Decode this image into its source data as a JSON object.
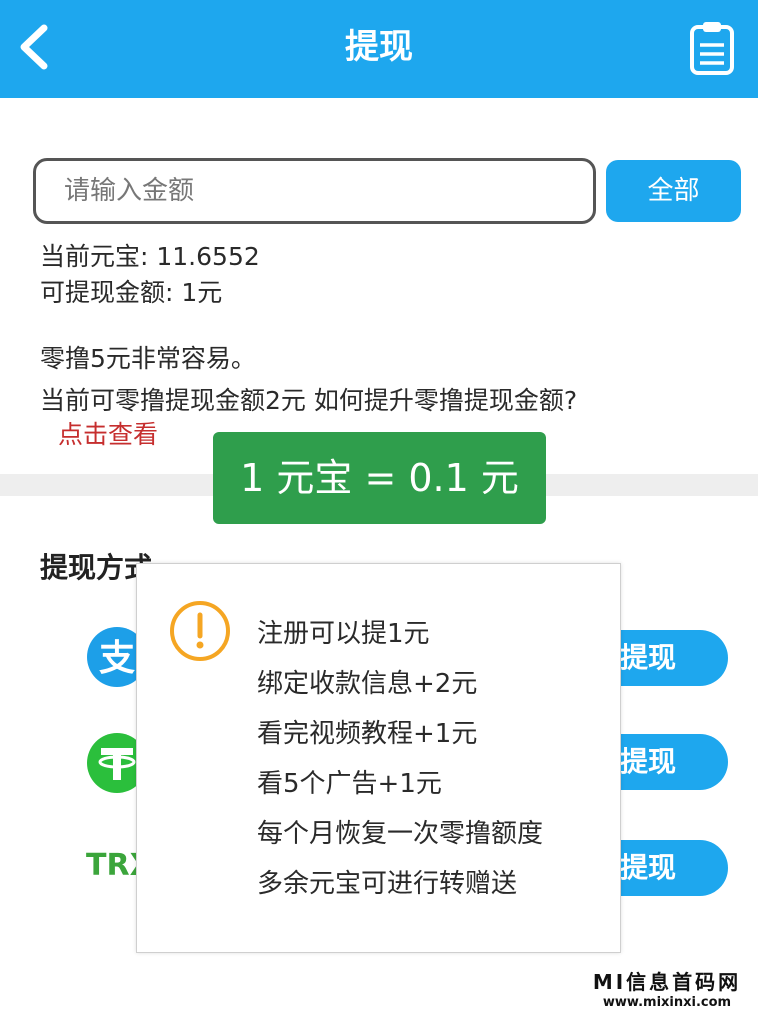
{
  "header": {
    "title": "提现",
    "back_icon": "chevron-left-icon",
    "records_icon": "clipboard-icon",
    "color": "#1ea7ee"
  },
  "amount": {
    "placeholder": "请输入金额",
    "value": "",
    "all_button": "全部"
  },
  "balance": {
    "current": "当前元宝: 11.6552",
    "withdrawable": "可提现金额: 1元"
  },
  "notice": {
    "line1": "零撸5元非常容易。",
    "line2": "当前可零撸提现金额2元 如何提升零撸提现金额?",
    "link": "点击查看"
  },
  "rate_banner": "1 元宝 = 0.1 元",
  "methods": {
    "title": "提现方式",
    "items": [
      {
        "icon": "alipay-icon",
        "button": "提现"
      },
      {
        "icon": "tether-icon",
        "button": "提现"
      },
      {
        "label": "TRX",
        "button": "提现"
      }
    ]
  },
  "popup": {
    "icon": "warning-icon",
    "tips": [
      "注册可以提1元",
      "绑定收款信息+2元",
      "看完视频教程+1元",
      "看5个广告+1元",
      "每个月恢复一次零撸额度",
      "多余元宝可进行转赠送"
    ]
  },
  "watermark": {
    "title": "MI信息首码网",
    "url": "www.mixinxi.com"
  },
  "colors": {
    "accent": "#1ea7ee",
    "banner": "#2f9e4c",
    "link": "#c62e2e",
    "warning": "#f5a623"
  }
}
